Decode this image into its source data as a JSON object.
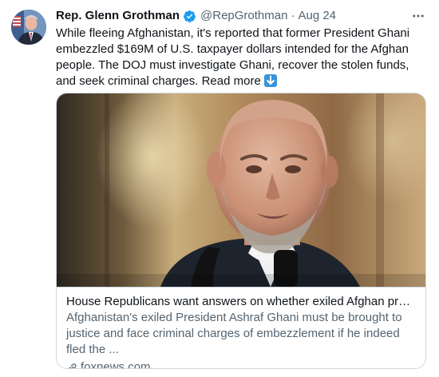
{
  "tweet": {
    "author_name": "Rep. Glenn Grothman",
    "handle": "@RepGrothman",
    "separator": "·",
    "date": "Aug 24",
    "text": "While fleeing Afghanistan, it's reported that former President Ghani embezzled $169M of U.S. taxpayer dollars intended for the Afghan people. The DOJ must investigate Ghani, recover the stolen funds, and seek criminal charges.",
    "read_more": "Read more",
    "icons": {
      "verified": "verified-badge-icon",
      "more": "more-options-icon",
      "read_more_emoji": "down-arrow-emoji-icon",
      "link": "link-icon"
    },
    "accent_color": "#1d9bf0"
  },
  "card": {
    "title": "House Republicans want answers on whether exiled Afghan president ...",
    "description": "Afghanistan's exiled President Ashraf Ghani must be brought to justice and face criminal charges of embezzlement if he indeed fled the ...",
    "domain": "foxnews.com"
  }
}
